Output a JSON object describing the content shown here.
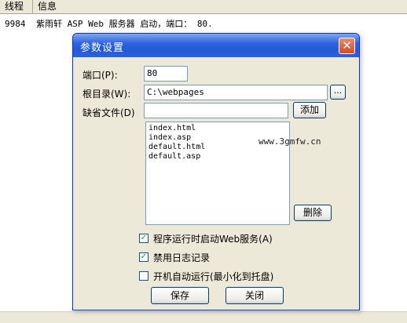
{
  "log": {
    "columns": [
      "线程",
      "信息"
    ],
    "rows": [
      {
        "thread": "9984",
        "message": "紫雨轩 ASP Web 服务器 启动，端口： 80."
      }
    ]
  },
  "dialog": {
    "title": "参数设置",
    "close_glyph": "✕",
    "port": {
      "label": "端口(P):",
      "value": "80"
    },
    "root": {
      "label": "根目录(W):",
      "value": "C:\\webpages",
      "browse_label": "..."
    },
    "default_doc": {
      "label": "缺省文件(D)",
      "value": "",
      "add_label": "添加"
    },
    "doc_list": [
      "index.html",
      "index.asp",
      "default.html",
      "default.asp"
    ],
    "watermark": "www.3gmfw.cn",
    "delete_label": "删除",
    "checkboxes": [
      {
        "label": "程序运行时启动Web服务(A)",
        "checked": true
      },
      {
        "label": "禁用日志记录",
        "checked": true
      },
      {
        "label": "开机自动运行(最小化到托盘)",
        "checked": false
      }
    ],
    "save_label": "保存",
    "close_label": "关闭"
  },
  "colors": {
    "title_bar": "#2459d6",
    "close_button": "#d6492a",
    "dialog_bg": "#ece9d8"
  }
}
